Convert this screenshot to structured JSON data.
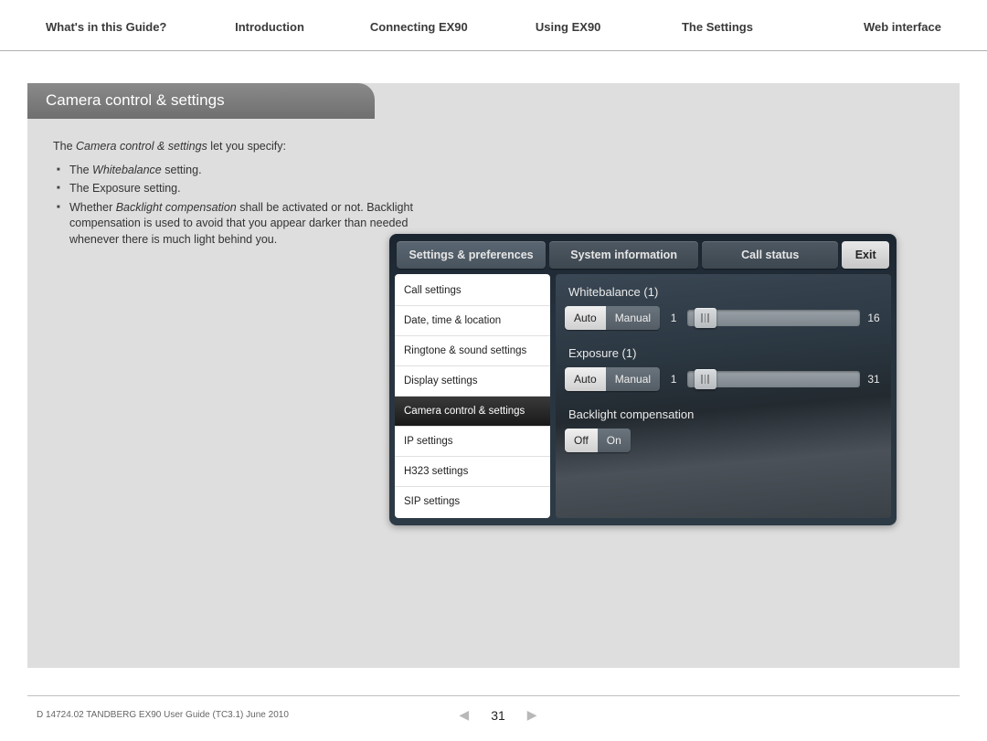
{
  "nav": {
    "items": [
      {
        "label": "What's in this Guide?"
      },
      {
        "label": "Introduction"
      },
      {
        "label": "Connecting EX90"
      },
      {
        "label": "Using EX90"
      },
      {
        "label": "The Settings"
      },
      {
        "label": "Web interface"
      }
    ]
  },
  "header": {
    "title": "Camera control & settings"
  },
  "description": {
    "intro_prefix": "The ",
    "intro_em": "Camera control & settings",
    "intro_suffix": " let you specify:",
    "bullets": {
      "b1_pre": "The ",
      "b1_em": "Whitebalance",
      "b1_post": " setting.",
      "b2": "The Exposure setting.",
      "b3_pre": "Whether ",
      "b3_em": "Backlight compensation",
      "b3_post": " shall be activated or not. Backlight compensation is used to avoid that you appear darker than needed whenever there is much light behind you."
    }
  },
  "device": {
    "tabs": {
      "settings": "Settings & preferences",
      "system": "System information",
      "call": "Call status",
      "exit": "Exit"
    },
    "sidebar": [
      {
        "label": "Call settings"
      },
      {
        "label": "Date, time & location"
      },
      {
        "label": "Ringtone & sound settings"
      },
      {
        "label": "Display settings"
      },
      {
        "label": "Camera control & settings"
      },
      {
        "label": "IP settings"
      },
      {
        "label": "H323 settings"
      },
      {
        "label": "SIP settings"
      }
    ],
    "settings": {
      "whitebalance": {
        "title": "Whitebalance (1)",
        "auto": "Auto",
        "manual": "Manual",
        "min": "1",
        "max": "16",
        "thumb_left_pct": 4
      },
      "exposure": {
        "title": "Exposure (1)",
        "auto": "Auto",
        "manual": "Manual",
        "min": "1",
        "max": "31",
        "thumb_left_pct": 4
      },
      "backlight": {
        "title": "Backlight compensation",
        "off": "Off",
        "on": "On"
      }
    }
  },
  "footer": {
    "doc_id": "D 14724.02 TANDBERG EX90 User Guide (TC3.1) June 2010",
    "page_number": "31"
  }
}
